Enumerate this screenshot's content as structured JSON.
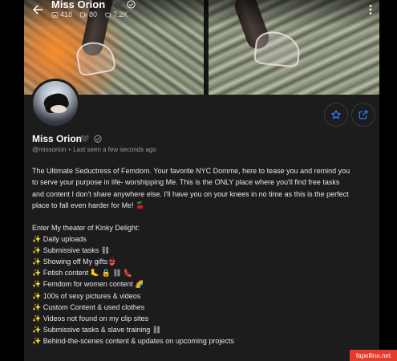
{
  "header": {
    "title": "Miss Orion",
    "title_emoji": "🖤",
    "stats": {
      "photos": "418",
      "videos": "80",
      "likes": "7.2K"
    }
  },
  "profile": {
    "name": "Miss Orion",
    "name_emoji": "🖤",
    "handle": "@missorion",
    "separator": "•",
    "last_seen": "Last seen a few seconds ago"
  },
  "bio": {
    "lines": [
      "The Ultimate Seductress of Femdom. Your favorite NYC Domme, here to tease you and remind you",
      "to serve your purpose in life- worshipping Me. This is the ONLY place where you'll find free tasks",
      "and content I don't share anywhere else. I'll have you on your knees in no time as this is the perfect",
      "place to fall even harder for Me! 🍒"
    ],
    "list_title": "Enter My theater of Kinky Delight:",
    "items": [
      "✨ Daily uploads",
      "✨ Submissive tasks ⛓",
      "✨ Showing off My gifts👙",
      "✨ Fetish content 🦶 🔒 ⛓ 👠",
      "✨ Femdom for women content 🌈",
      "✨ 100s of sexy pictures & videos",
      "✨  Custom Content & used clothes",
      "✨  Videos not found on my clip sites",
      "✨  Submissive tasks & slave training ⛓",
      "✨  Behind-the-scenes content & updates on upcoming projects"
    ]
  },
  "watermark": "fapellino.net",
  "colors": {
    "accent": "#2f80ff",
    "background": "#1c1c1c"
  }
}
